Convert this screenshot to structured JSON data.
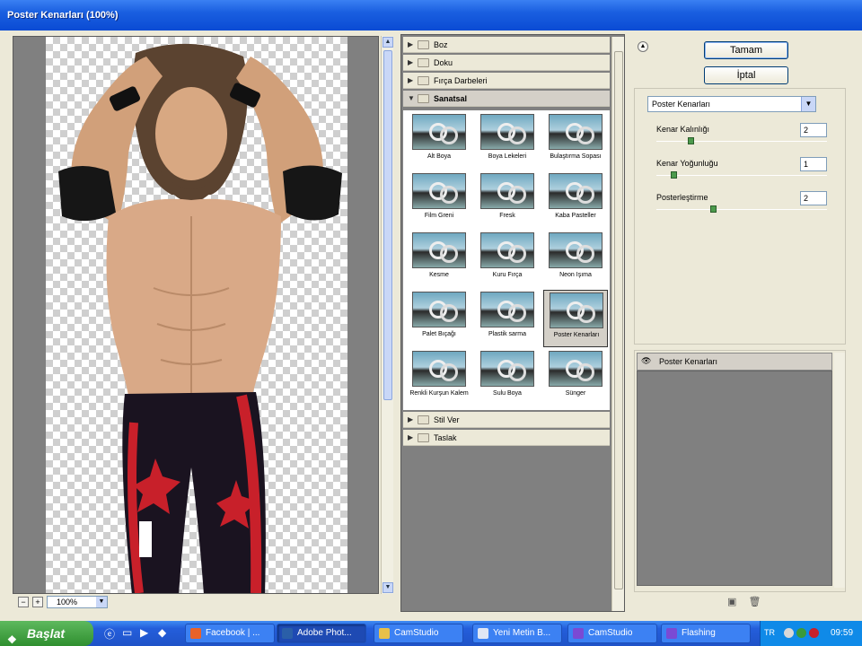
{
  "window": {
    "title": "Poster Kenarları (100%)"
  },
  "preview": {
    "zoom": "100%",
    "zoom_out": "−",
    "zoom_in": "+"
  },
  "gallery": {
    "categories_top": [
      {
        "label": "Boz",
        "expanded": false
      },
      {
        "label": "Doku",
        "expanded": false
      },
      {
        "label": "Fırça Darbeleri",
        "expanded": false
      },
      {
        "label": "Sanatsal",
        "expanded": true
      }
    ],
    "filters": [
      "Alt Boya",
      "Boya Lekeleri",
      "Bulaştırma Sopası",
      "Film Greni",
      "Fresk",
      "Kaba Pasteller",
      "Kesme",
      "Kuru Fırça",
      "Neon Işıma",
      "Palet Bıçağı",
      "Plastik sarma",
      "Poster Kenarları",
      "Renkli Kurşun Kalem",
      "Sulu Boya",
      "Sünger"
    ],
    "selected_filter": "Poster Kenarları",
    "categories_bottom": [
      {
        "label": "Stil Ver",
        "expanded": false
      },
      {
        "label": "Taslak",
        "expanded": false
      }
    ]
  },
  "buttons": {
    "ok": "Tamam",
    "cancel": "İptal"
  },
  "settings": {
    "filter_select": "Poster Kenarları",
    "params": [
      {
        "label": "Kenar Kalınlığı",
        "value": "2",
        "level": 0.2
      },
      {
        "label": "Kenar Yoğunluğu",
        "value": "1",
        "level": 0.1
      },
      {
        "label": "Posterleştirme",
        "value": "2",
        "level": 0.33
      }
    ]
  },
  "layers": {
    "items": [
      "Poster Kenarları"
    ]
  },
  "taskbar": {
    "start_label": "Başlat",
    "tasks": [
      {
        "label": "Facebook | ...",
        "color": "#e8622a",
        "active": false
      },
      {
        "label": "Adobe Phot...",
        "color": "#2a5fa8",
        "active": true
      },
      {
        "label": "CamStudio",
        "color": "#e8c04a",
        "active": false
      },
      {
        "label": "Yeni Metin B...",
        "color": "#dfe6f4",
        "active": false
      },
      {
        "label": "CamStudio",
        "color": "#7a4ad4",
        "active": false
      },
      {
        "label": "Flashing",
        "color": "#7a4ad4",
        "active": false
      }
    ],
    "lang": "TR",
    "clock": "09:59"
  }
}
